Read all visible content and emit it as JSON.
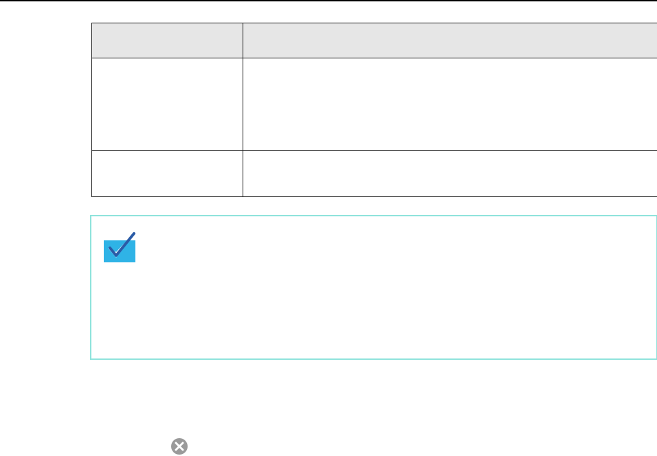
{
  "table": {
    "header": [
      "",
      ""
    ],
    "rows": [
      [
        "",
        ""
      ],
      [
        "",
        ""
      ]
    ]
  },
  "hint": {
    "icon": "checkmark-icon",
    "accent_color": "#2fb3e6",
    "border_color": "#8fe3dc"
  },
  "footer": {
    "icon": "close-icon",
    "icon_color": "#9a9a9a"
  }
}
